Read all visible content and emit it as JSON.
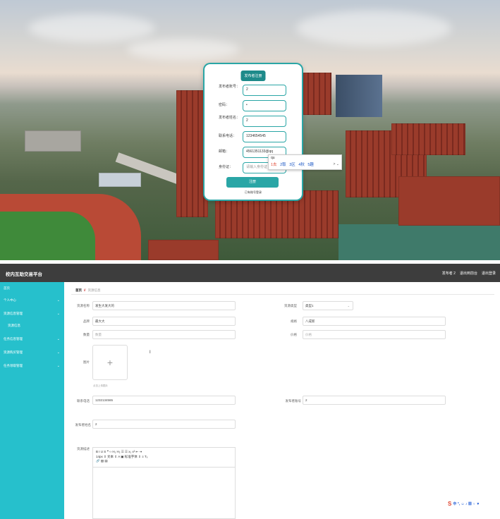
{
  "register": {
    "title": "发布者注册",
    "fields": [
      {
        "label": "发布者账号：",
        "value": "2",
        "placeholder": false
      },
      {
        "label": "密码：",
        "value": "•",
        "placeholder": false
      },
      {
        "label": "发布者姓名：",
        "value": "2",
        "placeholder": false
      },
      {
        "label": "联系电话：",
        "value": "1234654545",
        "placeholder": false
      },
      {
        "label": "邮箱：",
        "value": "4561351133@qq",
        "placeholder": false
      },
      {
        "label": "身份证：",
        "value": "请输入身份证",
        "placeholder": true
      }
    ],
    "submit_label": "注册",
    "login_link": "已有账号登录"
  },
  "ime": {
    "composition": "qu",
    "candidates": [
      "1去",
      "2取",
      "3区",
      "4秋",
      "5趣"
    ],
    "more": "> ⌄"
  },
  "app": {
    "title": "校内互助交易平台",
    "top_links": [
      "发布者 2",
      "退出到前台",
      "退出登录"
    ]
  },
  "sidebar": {
    "items": [
      {
        "label": "首页",
        "chevron": ""
      },
      {
        "label": "个人中心",
        "chevron": "⌄"
      },
      {
        "label": "资源信息管理",
        "chevron": "⌄"
      },
      {
        "label": "资源信息",
        "chevron": ""
      },
      {
        "label": "任务信息管理",
        "chevron": "⌄"
      },
      {
        "label": "资源购买管理",
        "chevron": "⌄"
      },
      {
        "label": "任务领取管理",
        "chevron": "⌄"
      }
    ]
  },
  "breadcrumb": {
    "home": "首页",
    "sep": "//",
    "current": "资源信息"
  },
  "form": {
    "resource_name": {
      "label": "资源名称",
      "value": "发生大发大的"
    },
    "resource_type": {
      "label": "资源类型",
      "value": "类型1",
      "caret": "⌄"
    },
    "brand": {
      "label": "品牌",
      "value": "最大大"
    },
    "spec": {
      "label": "规格",
      "value": "八成新"
    },
    "quantity": {
      "label": "数量",
      "value": "数量"
    },
    "price": {
      "label": "价格",
      "value": "价格"
    },
    "image": {
      "label": "图片",
      "plus": "+",
      "hint": "点击上传图片"
    },
    "phone": {
      "label": "联系电话",
      "value": "1232134565"
    },
    "publisher_account": {
      "label": "发布者账号",
      "value": "2"
    },
    "publisher_name": {
      "label": "发布者姓名",
      "value": "2"
    },
    "description": {
      "label": "资源描述"
    }
  },
  "editor_toolbar": {
    "row1": "B  I  U  S    ❝  ‹›    H₁  H₂    ☰  ☰    x₂  x²    ⇤  ⇥",
    "row2": "14px    ⇕    文本    ⇕    A  ▣    标准字体    ⇕    ≡    Tₓ",
    "row3": "🔗  ▨  ▤"
  },
  "ime_toolbar": {
    "logo": "S",
    "items": "中 °, ☺ ♪ ▦ ♀ ▼"
  },
  "text_cursor": "I"
}
